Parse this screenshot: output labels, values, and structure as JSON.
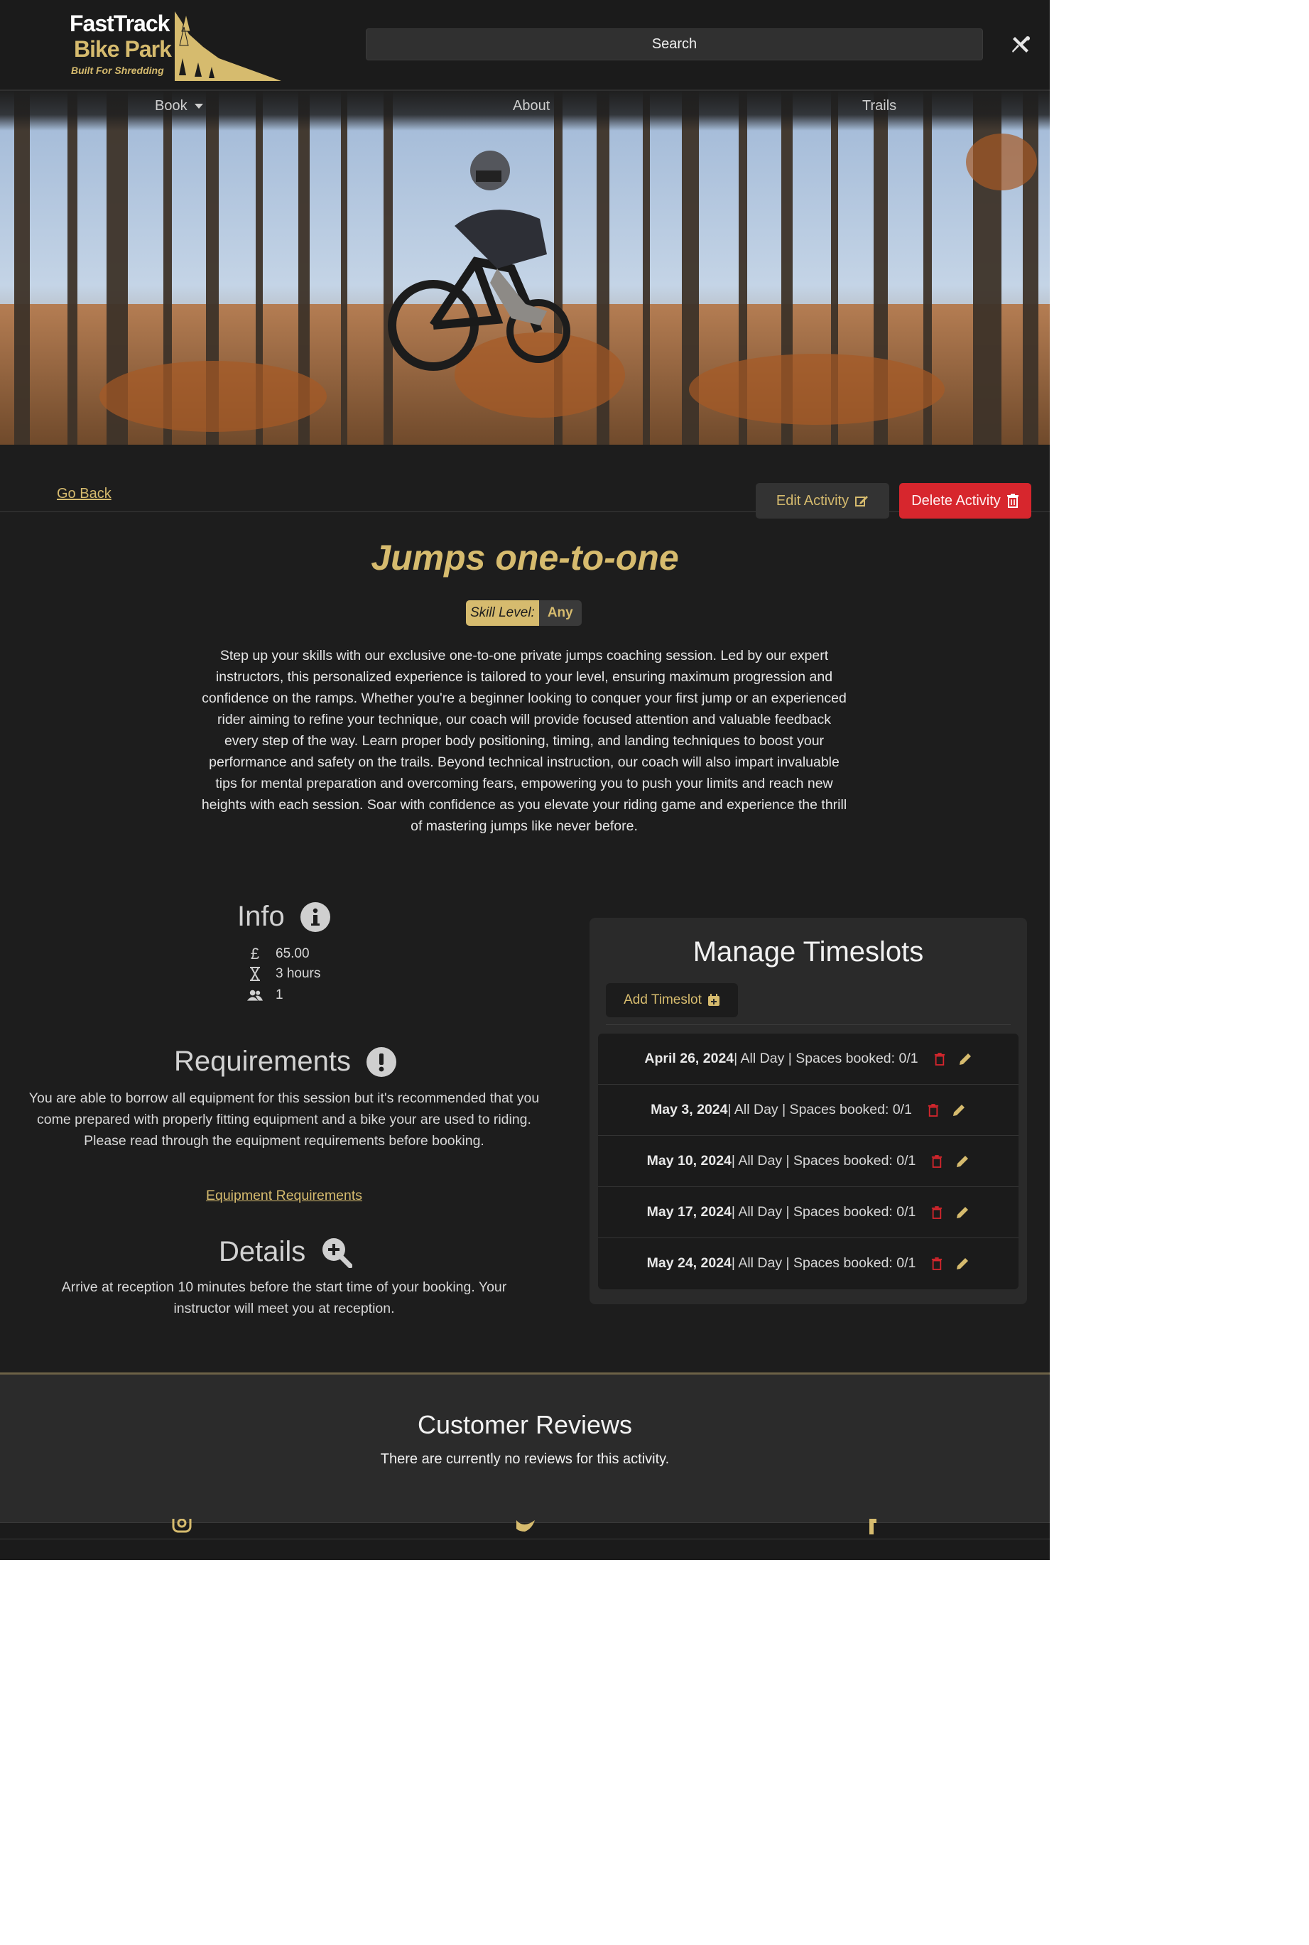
{
  "header": {
    "logo": {
      "line1": "FastTrack",
      "line2": "Bike Park",
      "tagline": "Built For Shredding"
    },
    "search_label": "Search",
    "close_icon": "close-tools-icon"
  },
  "nav": {
    "items": [
      {
        "label": "Book"
      },
      {
        "label": "About"
      },
      {
        "label": "Trails"
      }
    ]
  },
  "actions": {
    "go_back": "Go Back",
    "edit": "Edit Activity",
    "delete": "Delete Activity"
  },
  "activity": {
    "title": "Jumps one-to-one",
    "skill_label": "Skill Level:",
    "skill_value": "Any",
    "description": "Step up your skills with our exclusive one-to-one private jumps coaching session. Led by our expert instructors, this personalized experience is tailored to your level, ensuring maximum progression and confidence on the ramps. Whether you're a beginner looking to conquer your first jump or an experienced rider aiming to refine your technique, our coach will provide focused attention and valuable feedback every step of the way. Learn proper body positioning, timing, and landing techniques to boost your performance and safety on the trails. Beyond technical instruction, our coach will also impart invaluable tips for mental preparation and overcoming fears, empowering you to push your limits and reach new heights with each session. Soar with confidence as you elevate your riding game and experience the thrill of mastering jumps like never before."
  },
  "info": {
    "heading": "Info",
    "price": "65.00",
    "duration": "3 hours",
    "capacity": "1"
  },
  "requirements": {
    "heading": "Requirements",
    "text1": "You are able to borrow all equipment for this session but it's recommended that you come prepared with properly fitting equipment and a bike your are used to riding.",
    "text2": "Please read through the equipment requirements before booking.",
    "link": "Equipment Requirements"
  },
  "details": {
    "heading": "Details",
    "text": "Arrive at reception 10 minutes before the start time of your booking. Your instructor will meet you at reception."
  },
  "timeslots": {
    "heading": "Manage Timeslots",
    "add_label": "Add Timeslot",
    "items": [
      {
        "date": "April 26, 2024",
        "rest": " | All Day | Spaces booked: 0/1"
      },
      {
        "date": "May 3, 2024",
        "rest": " | All Day | Spaces booked: 0/1"
      },
      {
        "date": "May 10, 2024",
        "rest": " | All Day | Spaces booked: 0/1"
      },
      {
        "date": "May 17, 2024",
        "rest": " | All Day | Spaces booked: 0/1"
      },
      {
        "date": "May 24, 2024",
        "rest": " | All Day | Spaces booked: 0/1"
      }
    ]
  },
  "reviews": {
    "heading": "Customer Reviews",
    "text": "There are currently no reviews for this activity."
  },
  "colors": {
    "accent": "#d6bb6e",
    "danger": "#d7262d",
    "background": "#1d1d1d",
    "panel": "#2a2a2a"
  }
}
